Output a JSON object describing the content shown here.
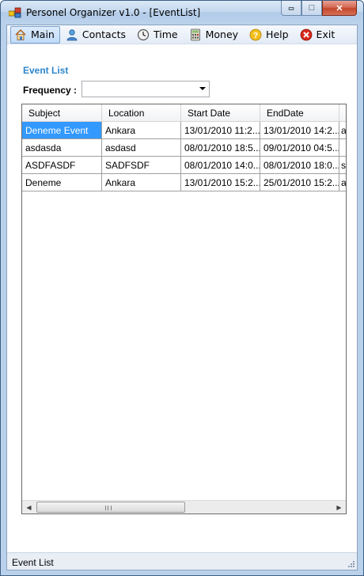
{
  "window": {
    "title": "Personel Organizer v1.0 - [EventList]",
    "caption": {
      "minimize": "▭",
      "maximize": "□",
      "close": "✕"
    }
  },
  "menu": {
    "items": [
      {
        "label": "Main",
        "icon": "home-icon",
        "active": true
      },
      {
        "label": "Contacts",
        "icon": "contacts-icon",
        "active": false
      },
      {
        "label": "Time",
        "icon": "clock-icon",
        "active": false
      },
      {
        "label": "Money",
        "icon": "calculator-icon",
        "active": false
      },
      {
        "label": "Help",
        "icon": "help-icon",
        "active": false
      },
      {
        "label": "Exit",
        "icon": "exit-icon",
        "active": false
      }
    ]
  },
  "page": {
    "section_title": "Event List",
    "frequency_label": "Frequency :",
    "frequency_value": ""
  },
  "grid": {
    "columns": [
      "Subject",
      "Location",
      "Start Date",
      "EndDate",
      ""
    ],
    "rows": [
      [
        "Deneme Event",
        "Ankara",
        "13/01/2010 11:2...",
        "13/01/2010 14:2...",
        "a"
      ],
      [
        "asdasda",
        "asdasd",
        "08/01/2010 18:5...",
        "09/01/2010 04:5...",
        ""
      ],
      [
        "ASDFASDF",
        "SADFSDF",
        "08/01/2010 14:0...",
        "08/01/2010 18:0...",
        "s"
      ],
      [
        "Deneme",
        "Ankara",
        "13/01/2010 15:2...",
        "25/01/2010 15:2...",
        "a"
      ]
    ],
    "selected_row": 0,
    "scroll_left_arrow": "◀",
    "scroll_right_arrow": "▶"
  },
  "status": {
    "text": "Event List"
  },
  "colors": {
    "accent": "#2e86cc",
    "selection": "#3399ff",
    "window_frame": "#b9d1ea",
    "close_button": "#c4452a"
  }
}
